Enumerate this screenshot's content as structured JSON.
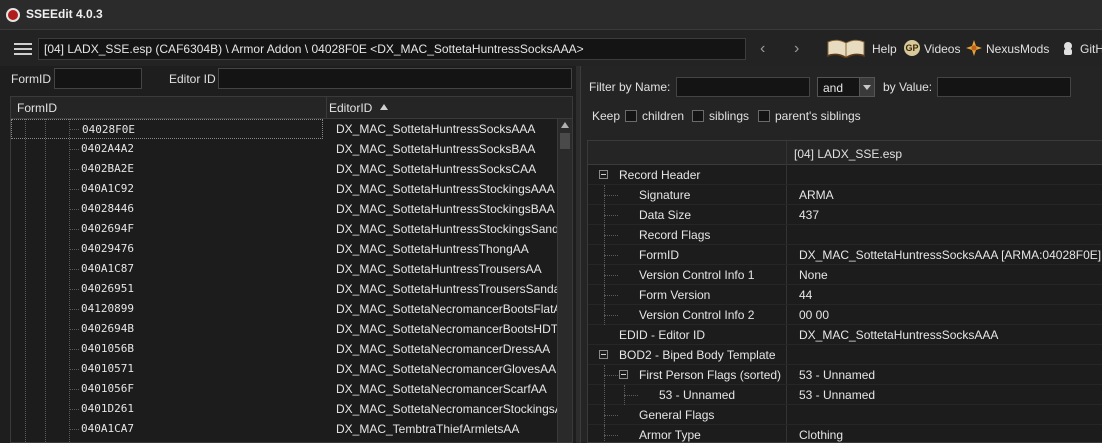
{
  "window": {
    "title": "SSEEdit 4.0.3"
  },
  "toolbar": {
    "path": "[04] LADX_SSE.esp (CAF6304B) \\ Armor Addon \\ 04028F0E <DX_MAC_SottetaHuntressSocksAAA>",
    "back_symbol": "‹",
    "forward_symbol": "›",
    "help_label": "Help",
    "videos_label": "Videos",
    "nexusmods_label": "NexusMods",
    "github_label": "GitH",
    "videos_icon_text": "GP",
    "icons": [
      "menu-icon",
      "back-icon",
      "forward-icon",
      "book-icon",
      "gp-icon",
      "nexus-icon",
      "github-icon"
    ]
  },
  "left": {
    "formid_label": "FormID",
    "editorid_label": "Editor ID",
    "formid_value": "",
    "editorid_value": "",
    "columns": {
      "formid": "FormID",
      "editorid": "EditorID"
    },
    "rows": [
      {
        "formid": "04028F0E",
        "editorid": "DX_MAC_SottetaHuntressSocksAAA"
      },
      {
        "formid": "0402A4A2",
        "editorid": "DX_MAC_SottetaHuntressSocksBAA"
      },
      {
        "formid": "0402BA2E",
        "editorid": "DX_MAC_SottetaHuntressSocksCAA"
      },
      {
        "formid": "040A1C92",
        "editorid": "DX_MAC_SottetaHuntressStockingsAAA"
      },
      {
        "formid": "04028446",
        "editorid": "DX_MAC_SottetaHuntressStockingsBAA"
      },
      {
        "formid": "0402694F",
        "editorid": "DX_MAC_SottetaHuntressStockingsSanda"
      },
      {
        "formid": "04029476",
        "editorid": "DX_MAC_SottetaHuntressThongAA"
      },
      {
        "formid": "040A1C87",
        "editorid": "DX_MAC_SottetaHuntressTrousersAA"
      },
      {
        "formid": "04026951",
        "editorid": "DX_MAC_SottetaHuntressTrousersSandals."
      },
      {
        "formid": "04120899",
        "editorid": "DX_MAC_SottetaNecromancerBootsFlatA"
      },
      {
        "formid": "0402694B",
        "editorid": "DX_MAC_SottetaNecromancerBootsHDTA"
      },
      {
        "formid": "0401056B",
        "editorid": "DX_MAC_SottetaNecromancerDressAA"
      },
      {
        "formid": "04010571",
        "editorid": "DX_MAC_SottetaNecromancerGlovesAA"
      },
      {
        "formid": "0401056F",
        "editorid": "DX_MAC_SottetaNecromancerScarfAA"
      },
      {
        "formid": "0401D261",
        "editorid": "DX_MAC_SottetaNecromancerStockingsA"
      },
      {
        "formid": "040A1CA7",
        "editorid": "DX_MAC_TembtraThiefArmletsAA"
      }
    ]
  },
  "right": {
    "filter_name_label": "Filter by Name:",
    "filter_name_value": "",
    "combo_value": "and",
    "filter_value_label": "by Value:",
    "filter_value_value": "",
    "keep_label": "Keep",
    "children_label": "children",
    "siblings_label": "siblings",
    "parents_siblings_label": "parent's siblings",
    "column_header": "[04] LADX_SSE.esp",
    "record_rows": [
      {
        "name": "Record Header",
        "value": "",
        "level": 0,
        "expander": true
      },
      {
        "name": "Signature",
        "value": "ARMA",
        "level": 1,
        "expander": false
      },
      {
        "name": "Data Size",
        "value": "437",
        "level": 1,
        "expander": false
      },
      {
        "name": "Record Flags",
        "value": "",
        "level": 1,
        "expander": false
      },
      {
        "name": "FormID",
        "value": "DX_MAC_SottetaHuntressSocksAAA [ARMA:04028F0E]",
        "level": 1,
        "expander": false
      },
      {
        "name": "Version Control Info 1",
        "value": "None",
        "level": 1,
        "expander": false
      },
      {
        "name": "Form Version",
        "value": "44",
        "level": 1,
        "expander": false
      },
      {
        "name": "Version Control Info 2",
        "value": "00 00",
        "level": 1,
        "expander": false
      },
      {
        "name": "EDID - Editor ID",
        "value": "DX_MAC_SottetaHuntressSocksAAA",
        "level": 0,
        "expander": false
      },
      {
        "name": "BOD2 - Biped Body Template",
        "value": "",
        "level": 0,
        "expander": true
      },
      {
        "name": "First Person Flags (sorted)",
        "value": "53 - Unnamed",
        "level": 1,
        "expander": true
      },
      {
        "name": "53 - Unnamed",
        "value": "53 - Unnamed",
        "level": 2,
        "expander": false
      },
      {
        "name": "General Flags",
        "value": "",
        "level": 1,
        "expander": false
      },
      {
        "name": "Armor Type",
        "value": "Clothing",
        "level": 1,
        "expander": false
      }
    ]
  },
  "colors": {
    "background": "#1e1e1e",
    "panel": "#242424",
    "input": "#141414",
    "text": "#dcdcdc",
    "app_icon_red": "#b01c1c"
  }
}
